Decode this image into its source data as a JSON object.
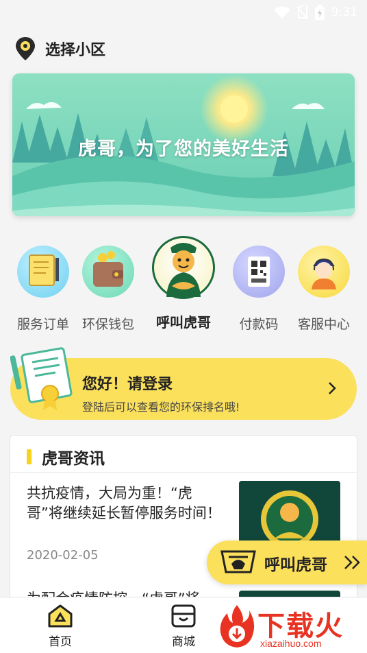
{
  "status": {
    "time": "9:31"
  },
  "location": {
    "label": "选择小区",
    "icon": "location-pin-icon"
  },
  "banner": {
    "slogan": "虎哥，为了您的美好生活"
  },
  "quick_actions": [
    {
      "label": "服务订单",
      "icon": "document-icon"
    },
    {
      "label": "环保钱包",
      "icon": "wallet-icon"
    },
    {
      "label": "呼叫虎哥",
      "icon": "tiger-mascot-icon"
    },
    {
      "label": "付款码",
      "icon": "qr-code-icon"
    },
    {
      "label": "客服中心",
      "icon": "customer-service-icon"
    }
  ],
  "login": {
    "title": "您好！请登录",
    "subtitle": "登陆后可以查看您的环保排名哦!"
  },
  "news": {
    "section_title": "虎哥资讯",
    "items": [
      {
        "headline": "共抗疫情，大局为重！“虎哥”将继续延长暂停服务时间！",
        "date": "2020-02-05"
      },
      {
        "headline": "为配合疫情防控，“虎哥”将"
      }
    ]
  },
  "float_button": {
    "label": "呼叫虎哥"
  },
  "tabs": [
    {
      "label": "首页",
      "icon": "home-icon"
    },
    {
      "label": "商城",
      "icon": "store-icon"
    }
  ],
  "watermark": {
    "text": "下载火",
    "url": "xiazaihuo.com"
  },
  "colors": {
    "accent": "#fbe05c",
    "banner": "#6fd2b3",
    "tiger_green": "#1b6b3e"
  }
}
